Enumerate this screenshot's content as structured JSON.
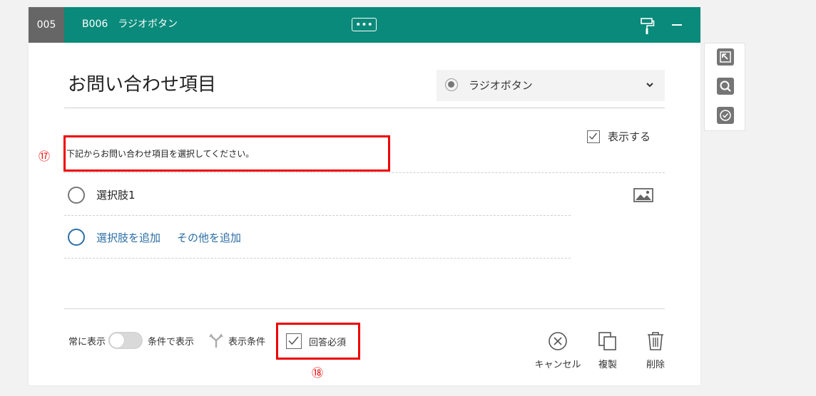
{
  "header": {
    "number": "005",
    "title": "B006　ラジオボタン",
    "more_label": "•••",
    "brush_icon": "paint-roller-icon",
    "minimize_icon": "minimize-icon",
    "color": "#098a7a"
  },
  "question": {
    "title": "お問い合わせ項目",
    "type_select": {
      "selected": "ラジオボタン",
      "icon": "radio-button-icon"
    },
    "show_description": {
      "label": "表示する",
      "checked": true
    },
    "description": "下記からお問い合わせ項目を選択してください。"
  },
  "annotations": {
    "marker_17": "⑰",
    "marker_18": "⑱",
    "highlight_color": "#e00000"
  },
  "choices": [
    {
      "label": "選択肢1"
    }
  ],
  "add_links": {
    "add_choice": "選択肢を追加",
    "add_other": "その他を追加",
    "color": "#2b6ea6"
  },
  "footer": {
    "always_show": "常に表示",
    "conditional_show": "条件で表示",
    "toggle_on": false,
    "display_condition": "表示条件",
    "required": {
      "label": "回答必須",
      "checked": true
    },
    "actions": {
      "cancel": "キャンセル",
      "duplicate": "複製",
      "delete": "削除"
    }
  },
  "side_panel": {
    "icons": [
      "move-up-icon",
      "search-icon",
      "check-circle-icon"
    ]
  }
}
